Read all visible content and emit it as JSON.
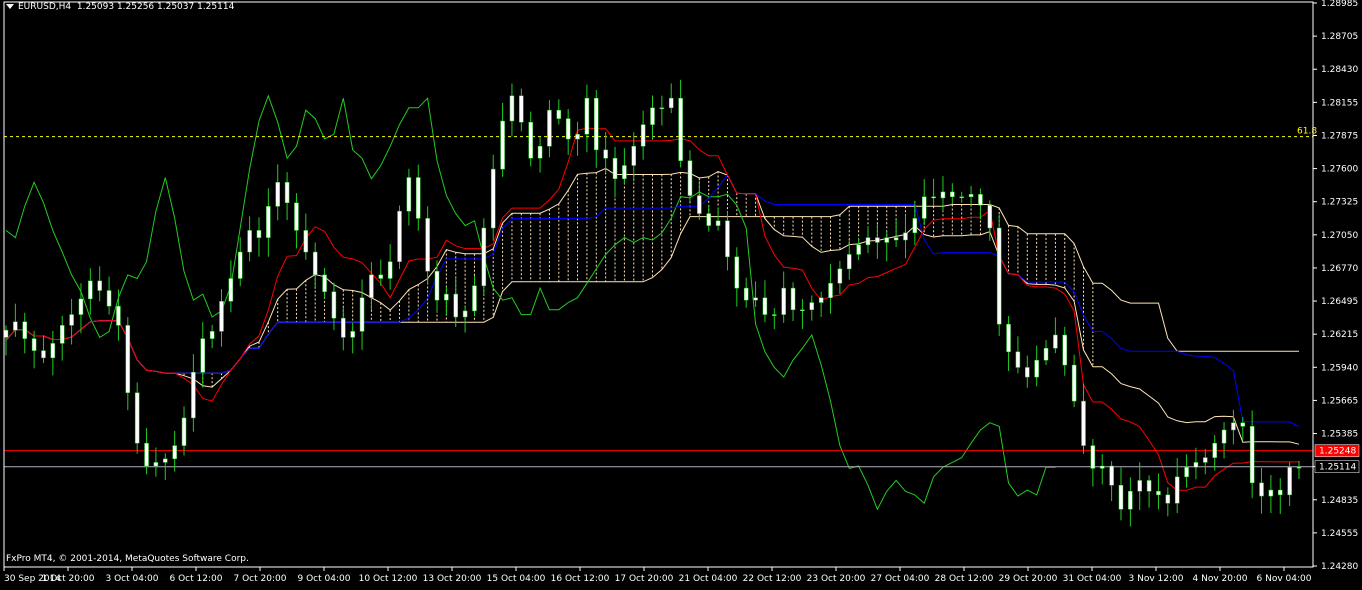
{
  "header": {
    "symbol": "EURUSD,H4",
    "ohlc": "1.25093 1.25256 1.25037 1.25114"
  },
  "copyright": "FxPro MT4, © 2001-2014, MetaQuotes Software Corp.",
  "colors": {
    "background": "#000000",
    "axis": "#ffffff",
    "candle": "#ffffff",
    "wick": "#22cc22",
    "tenkan": "#ff0000",
    "kijun": "#0000ff",
    "chikou": "#22cc22",
    "cloud": "#ffe4b5",
    "fib_line": "#ffff00",
    "hline_red": "#ff0000",
    "hline_grey": "#b0b0c0",
    "ask_label": "#ff0000"
  },
  "chart_data": {
    "type": "candlestick",
    "symbol": "EURUSD",
    "timeframe": "H4",
    "price_range": [
      1.2428,
      1.2898
    ],
    "y_ticks": [
      "1.28985",
      "1.28705",
      "1.28430",
      "1.28155",
      "1.27875",
      "1.27600",
      "1.27325",
      "1.27050",
      "1.26770",
      "1.26495",
      "1.26215",
      "1.25940",
      "1.25665",
      "1.25385",
      "1.25110",
      "1.24835",
      "1.24555",
      "1.24280"
    ],
    "x_ticks": [
      "30 Sep 2014",
      "1 Oct 20:00",
      "3 Oct 04:00",
      "6 Oct 12:00",
      "7 Oct 20:00",
      "9 Oct 04:00",
      "10 Oct 12:00",
      "13 Oct 20:00",
      "15 Oct 04:00",
      "16 Oct 12:00",
      "17 Oct 20:00",
      "21 Oct 04:00",
      "22 Oct 12:00",
      "23 Oct 20:00",
      "27 Oct 04:00",
      "28 Oct 12:00",
      "29 Oct 20:00",
      "31 Oct 04:00",
      "3 Nov 12:00",
      "4 Nov 20:00",
      "6 Nov 04:00"
    ],
    "current_price_label": "1.25114",
    "ask_price_label": "1.25248",
    "fib_label": "61.8",
    "fib_level": 1.2786,
    "hline_red": 1.25248,
    "hline_grey": 1.25114,
    "close": [
      1.2625,
      1.2632,
      1.2618,
      1.2608,
      1.2602,
      1.2614,
      1.2629,
      1.2638,
      1.2651,
      1.2666,
      1.2658,
      1.2645,
      1.2629,
      1.2573,
      1.2531,
      1.2512,
      1.2515,
      1.2518,
      1.2529,
      1.2552,
      1.259,
      1.2618,
      1.2624,
      1.2649,
      1.2668,
      1.269,
      1.2708,
      1.2702,
      1.2728,
      1.2748,
      1.2731,
      1.2708,
      1.269,
      1.2671,
      1.2657,
      1.2635,
      1.2619,
      1.2624,
      1.2652,
      1.2671,
      1.2668,
      1.2682,
      1.2724,
      1.2752,
      1.2718,
      1.2674,
      1.265,
      1.2655,
      1.2636,
      1.2641,
      1.2662,
      1.271,
      1.2759,
      1.2799,
      1.282,
      1.2798,
      1.2768,
      1.2778,
      1.2808,
      1.2801,
      1.2784,
      1.2788,
      1.2818,
      1.2775,
      1.2768,
      1.2751,
      1.2762,
      1.2778,
      1.2796,
      1.281,
      1.281,
      1.2818,
      1.2766,
      1.2737,
      1.2722,
      1.2712,
      1.2716,
      1.2686,
      1.266,
      1.265,
      1.2652,
      1.2638,
      1.2638,
      1.266,
      1.2642,
      1.2642,
      1.2648,
      1.2652,
      1.2664,
      1.2676,
      1.2688,
      1.2696,
      1.2702,
      1.2698,
      1.2702,
      1.27,
      1.2706,
      1.2718,
      1.2736,
      1.2735,
      1.274,
      1.2736,
      1.2736,
      1.2738,
      1.2729,
      1.271,
      1.263,
      1.2607,
      1.2594,
      1.2586,
      1.26,
      1.261,
      1.2621,
      1.2596,
      1.2566,
      1.2529,
      1.251,
      1.2512,
      1.2496,
      1.2476,
      1.2491,
      1.25,
      1.2491,
      1.2488,
      1.2481,
      1.2503,
      1.2511,
      1.2515,
      1.2519,
      1.2531,
      1.2542,
      1.2548,
      1.2545,
      1.2498,
      1.2487,
      1.2492,
      1.2488,
      1.2511,
      1.2511
    ],
    "series": [
      {
        "name": "Tenkan-sen"
      },
      {
        "name": "Kijun-sen"
      },
      {
        "name": "Chikou Span"
      },
      {
        "name": "Kumo"
      }
    ]
  }
}
